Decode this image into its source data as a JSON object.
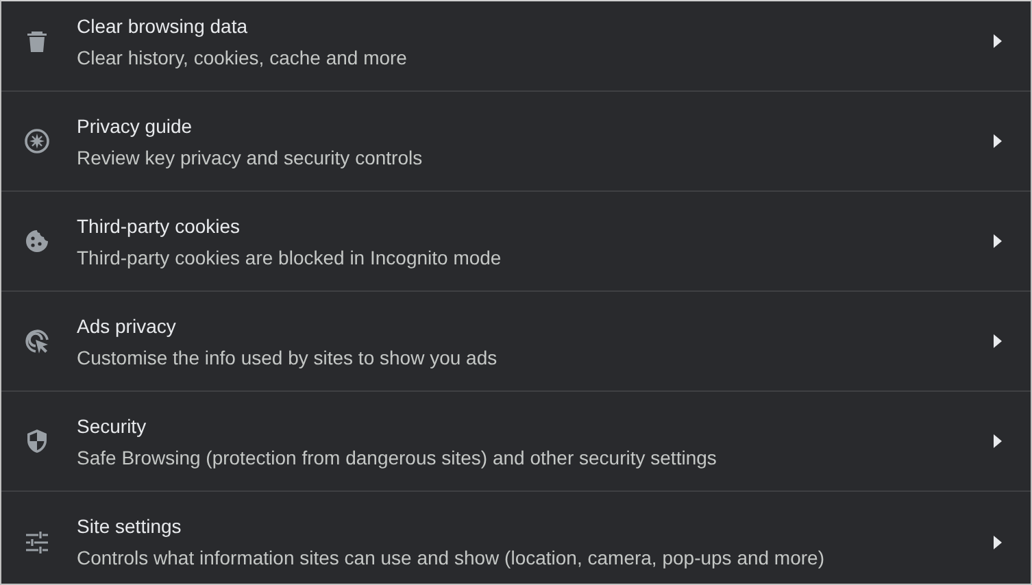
{
  "settings_rows": [
    {
      "kind": "trash",
      "title": "Clear browsing data",
      "description": "Clear history, cookies, cache and more"
    },
    {
      "kind": "compass",
      "title": "Privacy guide",
      "description": "Review key privacy and security controls"
    },
    {
      "kind": "cookie",
      "title": "Third-party cookies",
      "description": "Third-party cookies are blocked in Incognito mode"
    },
    {
      "kind": "ads",
      "title": "Ads privacy",
      "description": "Customise the info used by sites to show you ads"
    },
    {
      "kind": "shield",
      "title": "Security",
      "description": "Safe Browsing (protection from dangerous sites) and other security settings"
    },
    {
      "kind": "sliders",
      "title": "Site settings",
      "description": "Controls what information sites can use and show (location, camera, pop-ups and more)"
    }
  ]
}
